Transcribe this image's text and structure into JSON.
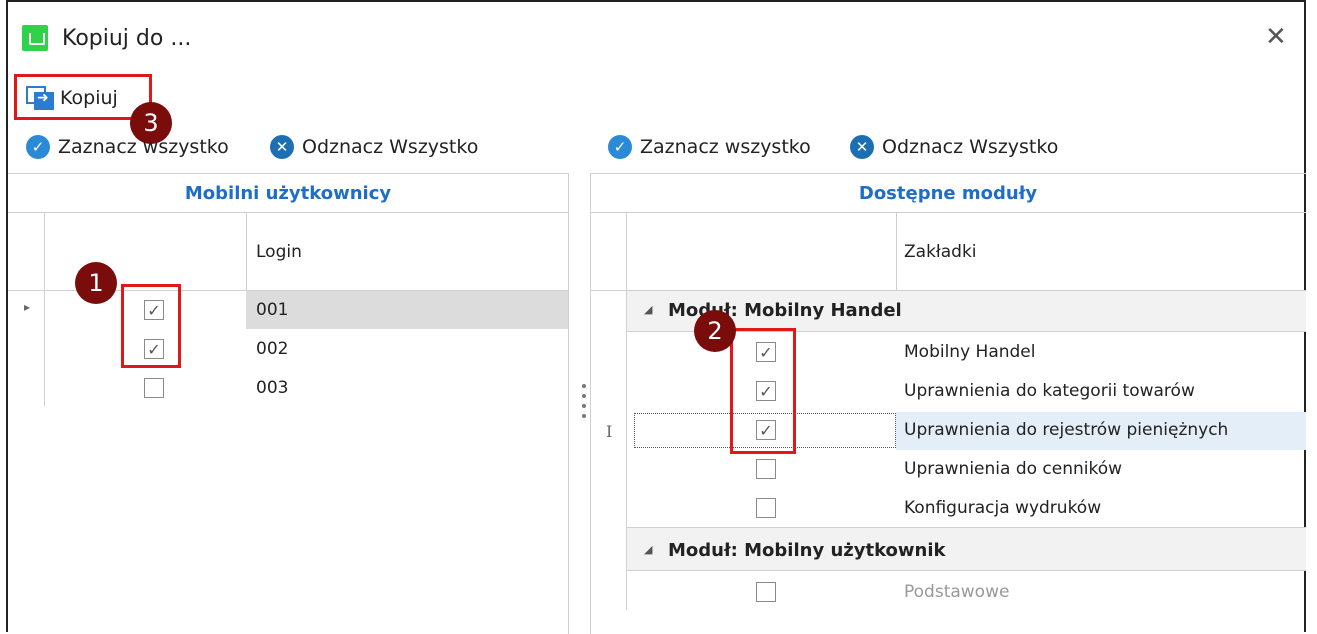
{
  "window": {
    "title": "Kopiuj do ...",
    "close_glyph": "✕"
  },
  "toolbar": {
    "copy_label": "Kopiuj"
  },
  "left": {
    "select_all": "Zaznacz wszystko",
    "deselect_all": "Odznacz Wszystko",
    "header": "Mobilni użytkownicy",
    "column_login": "Login",
    "rows": [
      {
        "login": "001",
        "checked": true
      },
      {
        "login": "002",
        "checked": true
      },
      {
        "login": "003",
        "checked": false
      }
    ]
  },
  "right": {
    "select_all": "Zaznacz wszystko",
    "deselect_all": "Odznacz Wszystko",
    "header": "Dostępne moduły",
    "column_tabs": "Zakładki",
    "groups": [
      {
        "title": "Moduł: Mobilny Handel",
        "items": [
          {
            "label": "Mobilny Handel",
            "checked": true
          },
          {
            "label": "Uprawnienia do kategorii towarów",
            "checked": true
          },
          {
            "label": "Uprawnienia do rejestrów pieniężnych",
            "checked": true
          },
          {
            "label": "Uprawnienia do cenników",
            "checked": false
          },
          {
            "label": "Konfiguracja wydruków",
            "checked": false
          }
        ]
      },
      {
        "title": "Moduł: Mobilny użytkownik",
        "items": [
          {
            "label": "Podstawowe",
            "checked": false
          }
        ]
      }
    ]
  },
  "annotations": {
    "badge1": "1",
    "badge2": "2",
    "badge3": "3"
  },
  "icons": {
    "check": "✓",
    "expand": "◢",
    "row_pointer": "▸",
    "text_cursor": "I"
  }
}
